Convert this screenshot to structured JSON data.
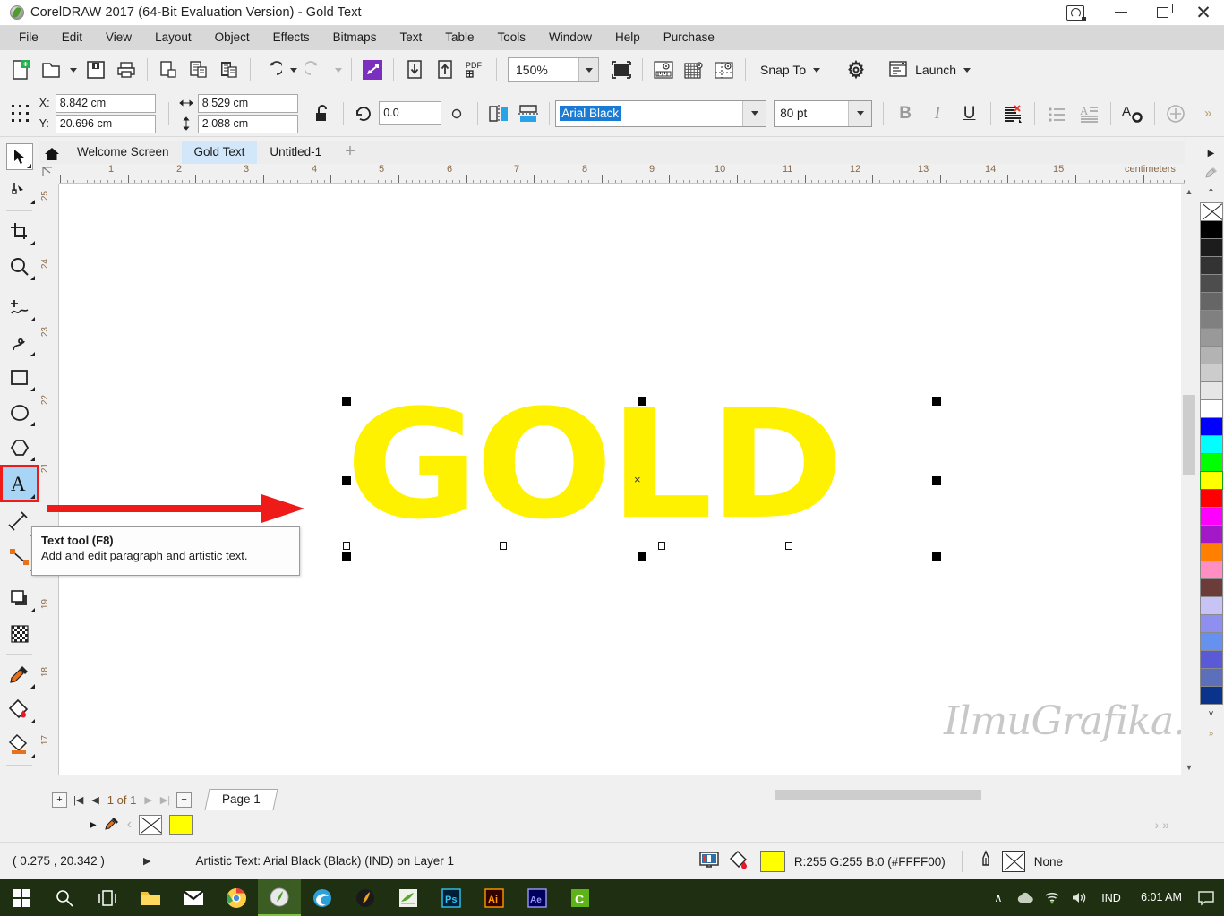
{
  "window": {
    "title": "CorelDRAW 2017 (64-Bit Evaluation Version) - Gold Text",
    "logo_icon": "coreldraw-balloon-icon",
    "user_icon": "user-account-icon",
    "minimize_label": "—",
    "maximize_label": "❐",
    "close_label": "✕"
  },
  "menubar": {
    "items": [
      {
        "label": "File",
        "accel": "F"
      },
      {
        "label": "Edit",
        "accel": "E"
      },
      {
        "label": "View",
        "accel": "V"
      },
      {
        "label": "Layout",
        "accel": "L"
      },
      {
        "label": "Object",
        "accel": "O"
      },
      {
        "label": "Effects",
        "accel": "c"
      },
      {
        "label": "Bitmaps",
        "accel": "B"
      },
      {
        "label": "Text",
        "accel": "x"
      },
      {
        "label": "Table",
        "accel": "T"
      },
      {
        "label": "Tools",
        "accel": "o"
      },
      {
        "label": "Window",
        "accel": "W"
      },
      {
        "label": "Help",
        "accel": "H"
      },
      {
        "label": "Purchase",
        "accel": ""
      }
    ]
  },
  "standard_toolbar": {
    "buttons": [
      {
        "name": "new-document-icon",
        "title": "New"
      },
      {
        "name": "open-document-icon",
        "title": "Open"
      },
      {
        "name": "save-document-icon",
        "title": "Save"
      },
      {
        "name": "print-icon",
        "title": "Print"
      },
      {
        "name": "cut-icon",
        "title": "Cut"
      },
      {
        "name": "copy-icon",
        "title": "Copy"
      },
      {
        "name": "paste-icon",
        "title": "Paste"
      },
      {
        "name": "undo-icon",
        "title": "Undo"
      },
      {
        "name": "redo-icon",
        "title": "Redo"
      },
      {
        "name": "corel-connect-icon",
        "title": "Search Content"
      },
      {
        "name": "import-icon",
        "title": "Import"
      },
      {
        "name": "export-icon",
        "title": "Export"
      },
      {
        "name": "publish-pdf-icon",
        "title": "Publish to PDF"
      }
    ],
    "zoom_level": "150%",
    "fullscreen_icon": "full-screen-preview-icon",
    "view_toggles": [
      {
        "name": "show-rulers-icon"
      },
      {
        "name": "show-grid-icon"
      },
      {
        "name": "show-guidelines-icon"
      }
    ],
    "snap_to_label": "Snap To",
    "options_icon": "options-gear-icon",
    "launch_label": "Launch",
    "launch_icon": "launch-application-icon"
  },
  "property_bar": {
    "object_origin_icon": "object-origin-icon",
    "x_label": "X:",
    "x_value": "8.842 cm",
    "y_label": "Y:",
    "y_value": "20.696 cm",
    "width_icon": "object-width-icon",
    "width_value": "8.529 cm",
    "height_icon": "object-height-icon",
    "height_value": "2.088 cm",
    "lock_ratio_icon": "lock-ratio-open-icon",
    "rotation_icon": "angle-of-rotation-icon",
    "rotation_value": "0.0",
    "degree_symbol": "°",
    "mirror_horizontal_icon": "mirror-horizontally-icon",
    "mirror_vertical_icon": "mirror-vertically-icon",
    "font_name": "Arial Black",
    "font_size": "80 pt",
    "bold_label": "B",
    "italic_label": "I",
    "underline_label": "U",
    "text_alignment_icon": "text-alignment-none-icon",
    "bullet_list_icon": "bulleted-list-icon",
    "drop_cap_icon": "drop-cap-icon",
    "text_properties_icon": "text-properties-icon",
    "add_icon": "add-object-icon",
    "overflow_label": "»"
  },
  "document_tabs": {
    "home_icon": "welcome-home-icon",
    "tabs": [
      {
        "label": "Welcome Screen",
        "active": false
      },
      {
        "label": "Gold Text",
        "active": true
      },
      {
        "label": "Untitled-1",
        "active": false
      }
    ],
    "add_tab_label": "+"
  },
  "toolbox": {
    "tools": [
      {
        "name": "pick-tool",
        "label": "Pick tool",
        "glyph": "▶",
        "selected": false
      },
      {
        "name": "shape-tool",
        "label": "Shape tool",
        "glyph": "↳",
        "selected": false
      },
      {
        "name": "crop-tool",
        "label": "Crop tool",
        "glyph": "✚",
        "selected": false
      },
      {
        "name": "zoom-tool",
        "label": "Zoom tool",
        "glyph": "⚲",
        "selected": false
      },
      {
        "name": "freehand-tool",
        "label": "Freehand tool",
        "glyph": "∿",
        "selected": false
      },
      {
        "name": "artistic-media-tool",
        "label": "Artistic media tool",
        "glyph": "∿",
        "selected": false
      },
      {
        "name": "rectangle-tool",
        "label": "Rectangle tool",
        "glyph": "□",
        "selected": false
      },
      {
        "name": "ellipse-tool",
        "label": "Ellipse tool",
        "glyph": "○",
        "selected": false
      },
      {
        "name": "polygon-tool",
        "label": "Polygon tool",
        "glyph": "⬡",
        "selected": false
      },
      {
        "name": "text-tool",
        "label": "Text tool",
        "glyph": "A",
        "selected": true
      },
      {
        "name": "parallel-dimension-tool",
        "label": "Parallel dimension tool",
        "glyph": "╱",
        "selected": false
      },
      {
        "name": "straight-line-connector-tool",
        "label": "Straight-line connector tool",
        "glyph": "╲",
        "selected": false
      },
      {
        "name": "drop-shadow-tool",
        "label": "Drop shadow tool",
        "glyph": "▣",
        "selected": false
      },
      {
        "name": "transparency-tool",
        "label": "Transparency tool",
        "glyph": "▒",
        "selected": false
      },
      {
        "name": "color-eyedropper-tool",
        "label": "Color eyedropper tool",
        "glyph": "✒",
        "selected": false
      },
      {
        "name": "interactive-fill-tool",
        "label": "Interactive fill tool",
        "glyph": "◆",
        "selected": false
      },
      {
        "name": "smart-fill-tool",
        "label": "Smart fill tool",
        "glyph": "◇",
        "selected": false
      }
    ]
  },
  "tooltip": {
    "title": "Text tool (F8)",
    "description": "Add and edit paragraph and artistic text."
  },
  "annotation": {
    "arrow_color": "#ee1b18",
    "arrow_points_to": "text-tool"
  },
  "rulers": {
    "unit_label": "centimeters",
    "horizontal_ticks": [
      "1",
      "2",
      "3",
      "4",
      "5",
      "6",
      "7",
      "8",
      "9",
      "10",
      "11",
      "12",
      "13",
      "14",
      "15"
    ],
    "vertical_ticks": [
      "25",
      "24",
      "23",
      "22",
      "21",
      "20",
      "19",
      "18",
      "17"
    ]
  },
  "canvas": {
    "artwork_text": "GOLD",
    "artwork_fill_hex": "#FFFF00",
    "selection_center_marker": "×",
    "watermark": "IlmuGrafika.id"
  },
  "page_nav": {
    "add_page_start_icon": "add-page-before-icon",
    "first_label": "|◀",
    "prev_label": "◀",
    "page_indicator": "1  of  1",
    "next_label": "▶",
    "last_label": "▶|",
    "add_page_end_icon": "add-page-after-icon",
    "page_tab_label": "Page 1"
  },
  "color_strip": {
    "expand_icon": "palette-expand-icon",
    "eyedropper_icon": "eyedropper-icon",
    "scroll_left_label": "‹",
    "no_color_label": "No color",
    "selected_color_hex": "#FFFF00"
  },
  "statusbar": {
    "coordinates": "( 0.275 , 20.342 )",
    "expand_arrow": "▶",
    "object_info": "Artistic Text: Arial Black (Black) (IND) on Layer 1",
    "document_color_icon": "document-color-settings-icon",
    "fill_icon": "fill-color-icon",
    "fill_value": "R:255 G:255 B:0 (#FFFF00)",
    "outline_icon": "outline-pen-icon",
    "outline_value": "None"
  },
  "palette": {
    "scroll_up_label": "▲",
    "scroll_down_label": "˅",
    "expand_label": "»",
    "top_arrow_icon": "palette-pointer-icon",
    "top_eyedropper_icon": "palette-eyedropper-icon",
    "colors": [
      {
        "name": "none",
        "hex": "none"
      },
      {
        "name": "black",
        "hex": "#000000"
      },
      {
        "name": "gray-90",
        "hex": "#1c1c1c"
      },
      {
        "name": "gray-80",
        "hex": "#333333"
      },
      {
        "name": "gray-70",
        "hex": "#4d4d4d"
      },
      {
        "name": "gray-60",
        "hex": "#666666"
      },
      {
        "name": "gray-50",
        "hex": "#808080"
      },
      {
        "name": "gray-40",
        "hex": "#999999"
      },
      {
        "name": "gray-30",
        "hex": "#b3b3b3"
      },
      {
        "name": "gray-20",
        "hex": "#cccccc"
      },
      {
        "name": "gray-10",
        "hex": "#e6e6e6"
      },
      {
        "name": "white",
        "hex": "#ffffff"
      },
      {
        "name": "blue",
        "hex": "#0000ff"
      },
      {
        "name": "cyan",
        "hex": "#00ffff"
      },
      {
        "name": "green",
        "hex": "#00ff00"
      },
      {
        "name": "yellow",
        "hex": "#ffff00"
      },
      {
        "name": "red",
        "hex": "#ff0000"
      },
      {
        "name": "magenta",
        "hex": "#ff00ff"
      },
      {
        "name": "purple",
        "hex": "#a319c8"
      },
      {
        "name": "orange",
        "hex": "#ff7f00"
      },
      {
        "name": "pink",
        "hex": "#ff8fc2"
      },
      {
        "name": "brown",
        "hex": "#6b3c38"
      },
      {
        "name": "lavender",
        "hex": "#c8c3f5"
      },
      {
        "name": "periwinkle",
        "hex": "#8f8ff0"
      },
      {
        "name": "cornflower",
        "hex": "#6691ef"
      },
      {
        "name": "blue-violet",
        "hex": "#5a5ad6"
      },
      {
        "name": "slate-blue",
        "hex": "#5c6fbb"
      },
      {
        "name": "navy",
        "hex": "#0a348c"
      }
    ]
  },
  "taskbar": {
    "items": [
      {
        "name": "start-button",
        "label": "Start"
      },
      {
        "name": "search-icon",
        "label": "Search"
      },
      {
        "name": "task-view-icon",
        "label": "Task View"
      },
      {
        "name": "file-explorer-icon",
        "label": "File Explorer"
      },
      {
        "name": "mail-icon",
        "label": "Mail"
      },
      {
        "name": "chrome-icon",
        "label": "Google Chrome"
      },
      {
        "name": "coreldraw-icon",
        "label": "CorelDRAW 2017"
      },
      {
        "name": "edge-icon",
        "label": "Microsoft Edge"
      },
      {
        "name": "corel-photo-paint-icon",
        "label": "Corel PHOTO-PAINT"
      },
      {
        "name": "utorrent-icon",
        "label": "uTorrent"
      },
      {
        "name": "photoshop-icon",
        "label": "Ps"
      },
      {
        "name": "illustrator-icon",
        "label": "Ai"
      },
      {
        "name": "after-effects-icon",
        "label": "Ae"
      },
      {
        "name": "corel-capture-icon",
        "label": "C"
      }
    ],
    "tray": {
      "show_hidden_label": "∧",
      "cloud_icon": "onedrive-cloud-icon",
      "network_icon": "wifi-icon",
      "volume_icon": "volume-icon",
      "language": "IND",
      "time": "6:01 AM",
      "action_center_icon": "action-center-icon"
    }
  }
}
